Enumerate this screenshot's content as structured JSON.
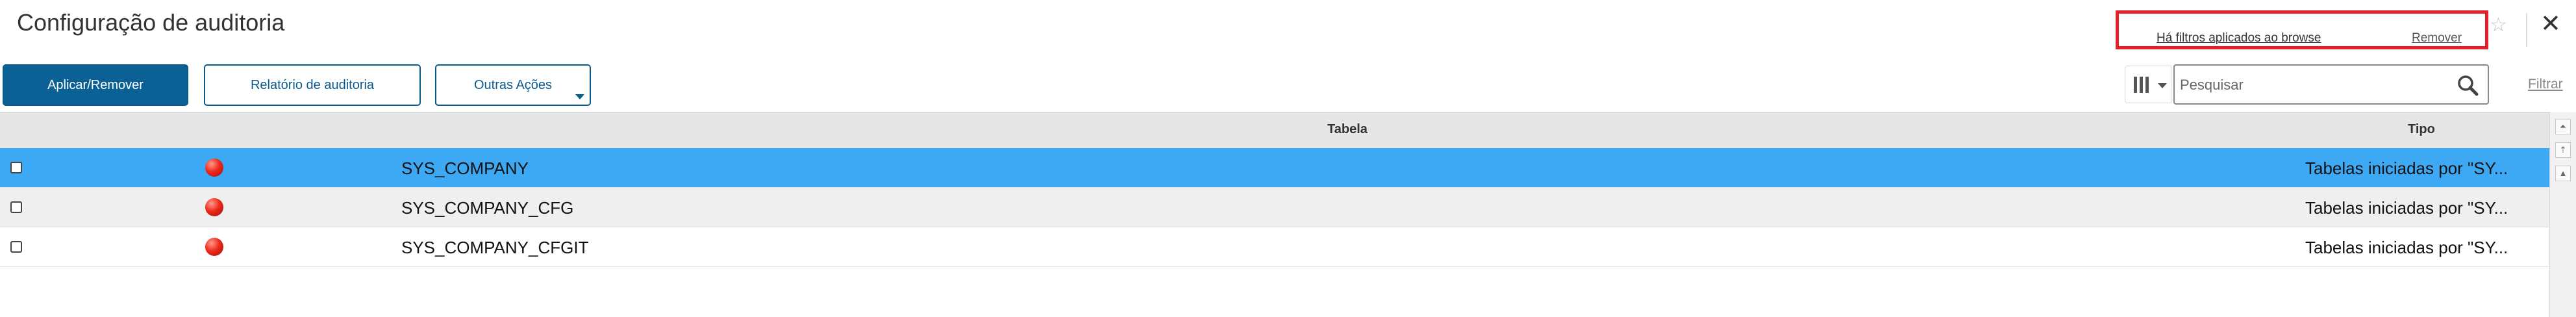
{
  "header": {
    "title": "Configuração de auditoria",
    "filter_notice": "Há filtros aplicados ao browse",
    "filter_remove": "Remover"
  },
  "toolbar": {
    "apply_label": "Aplicar/Remover",
    "report_label": "Relatório de auditoria",
    "more_label": "Outras Ações",
    "filter_link": "Filtrar"
  },
  "search": {
    "placeholder": "Pesquisar",
    "value": ""
  },
  "table": {
    "columns": [
      "Tabela",
      "Tipo"
    ],
    "rows": [
      {
        "name": "SYS_COMPANY",
        "type": "Tabelas iniciadas por \"SY...",
        "selected": true
      },
      {
        "name": "SYS_COMPANY_CFG",
        "type": "Tabelas iniciadas por \"SY...",
        "selected": false
      },
      {
        "name": "SYS_COMPANY_CFGIT",
        "type": "Tabelas iniciadas por \"SY...",
        "selected": false
      }
    ]
  },
  "icons": {
    "favorite": "star-icon",
    "close": "close-icon",
    "columns": "columns-icon",
    "search": "search-icon",
    "status": "status-dot-icon"
  },
  "colors": {
    "primary": "#0b6196",
    "selected_row": "#3da9f5",
    "highlight_border": "#e4202b",
    "status_red": "#ee2a1c"
  }
}
